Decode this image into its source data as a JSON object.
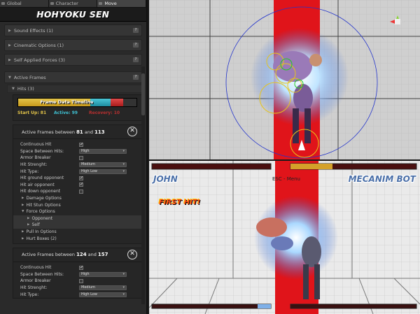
{
  "tabs": [
    {
      "label": "Global"
    },
    {
      "label": "Character"
    },
    {
      "label": "Move"
    }
  ],
  "logo": "HOHYOKU SEN",
  "sections": {
    "sound_effects": "Sound Effects (1)",
    "cinematic_options": "Cinematic Options (1)",
    "self_applied_forces": "Self Applied Forces (3)",
    "active_frames": "Active Frames",
    "hits": "Hits (3)",
    "help_glyph": "?"
  },
  "timeline": {
    "label": "Frame Data Timeline",
    "startup_label": "Start Up: 81",
    "active_label": "Active: 99",
    "recovery_label": "Recovery: 10",
    "startup_color": "#e3c449",
    "active_color": "#3fc1d3",
    "recovery_color": "#b83030"
  },
  "active_frame_1": {
    "prefix": "Active Frames",
    "between": "between",
    "start": "81",
    "and": "and",
    "end": "113",
    "rows": {
      "continuous_hit": "Continuous Hit",
      "space_between_hits": "Space Between Hits:",
      "space_value": "High",
      "armor_breaker": "Armor Breaker",
      "hit_strength": "Hit Strenght:",
      "hit_strength_value": "Medium",
      "hit_type": "Hit Type:",
      "hit_type_value": "High Low",
      "hit_ground": "Hit ground opponent",
      "hit_air": "Hit air opponent",
      "hit_down": "Hit down opponent",
      "damage_options": "Damage Options",
      "hit_stun_options": "Hit Stun Options",
      "force_options": "Force Options",
      "opponent": "Opponent",
      "self": "Self",
      "pull_in_options": "Pull In Options",
      "hurt_boxes": "Hurt Boxes (2)"
    }
  },
  "active_frame_2": {
    "prefix": "Active Frames",
    "between": "between",
    "start": "124",
    "and": "and",
    "end": "157",
    "rows": {
      "continuous_hit": "Continuous Hit",
      "space_between_hits": "Space Between Hits:",
      "space_value": "High",
      "armor_breaker": "Armor Breaker",
      "hit_strength": "Hit Strenght:",
      "hit_strength_value": "Medium",
      "hit_type": "Hit Type:",
      "hit_type_value": "High Low"
    }
  },
  "close_glyph": "✕",
  "check_glyph": "✓",
  "game": {
    "player1": "JOHN",
    "player2": "MECANIM BOT",
    "esc_label": "ESC - Menu",
    "first_hit": "FIRST HIT!"
  },
  "colors": {
    "accent_red": "#e0141a",
    "panel": "#2a2a2a"
  }
}
